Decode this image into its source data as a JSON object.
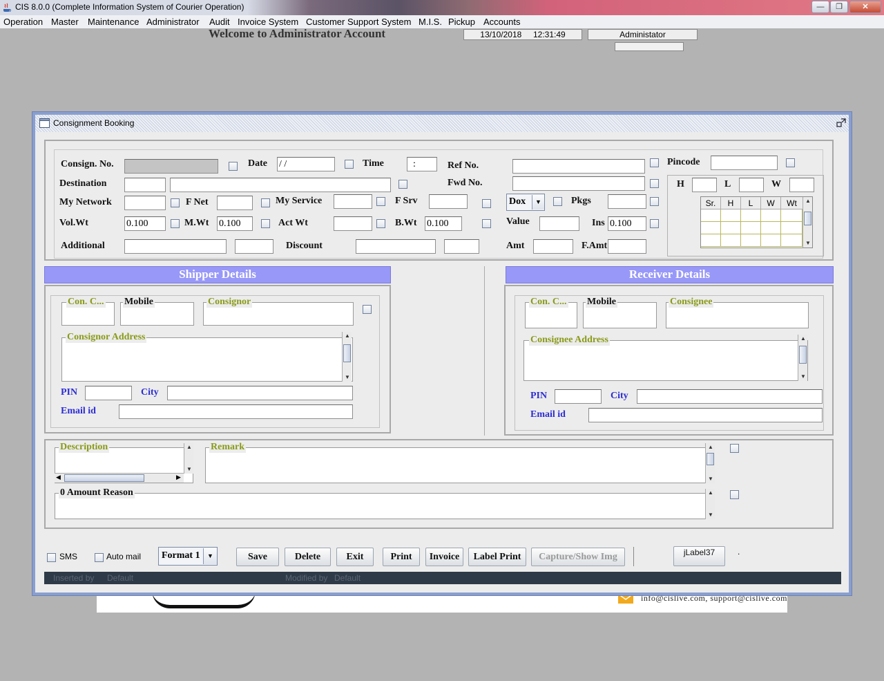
{
  "window": {
    "title": "CIS 8.0.0 (Complete Information System of Courier Operation)",
    "minimize_glyph": "—",
    "maximize_glyph": "❐",
    "close_glyph": "✕"
  },
  "menu": [
    "Operation",
    "Master",
    "Maintenance",
    "Administrator",
    "Audit",
    "Invoice System",
    "Customer Support System",
    "M.I.S.",
    "Pickup",
    "Accounts"
  ],
  "header": {
    "welcome": "Welcome to Administrator Account",
    "date": "13/10/2018",
    "time": "12:31:49",
    "user": "Administator"
  },
  "background_footer": {
    "emails": "info@cislive.com, support@cislive.com"
  },
  "frame": {
    "title": "Consignment Booking"
  },
  "booking": {
    "consign_no_label": "Consign. No.",
    "date_label": "Date",
    "date_value": " /  /",
    "time_label": "Time",
    "time_value": ":",
    "ref_no_label": "Ref No.",
    "pincode_label": "Pincode",
    "destination_label": "Destination",
    "fwd_no_label": "Fwd No.",
    "my_network_label": "My Network",
    "f_net_label": "F Net",
    "my_service_label": "My Service",
    "f_srv_label": "F Srv",
    "dox_value": "Dox",
    "pkgs_label": "Pkgs",
    "vol_wt_label": "Vol.Wt",
    "vol_wt_value": "0.100",
    "m_wt_label": "M.Wt",
    "m_wt_value": "0.100",
    "act_wt_label": "Act Wt",
    "b_wt_label": "B.Wt",
    "b_wt_value": "0.100",
    "value_label": "Value",
    "ins_label": "Ins",
    "ins_value": "0.100",
    "additional_label": "Additional",
    "discount_label": "Discount",
    "amt_label": "Amt",
    "f_amt_label": "F.Amt"
  },
  "dimensions": {
    "h_label": "H",
    "l_label": "L",
    "w_label": "W",
    "columns": [
      "Sr.",
      "H",
      "L",
      "W",
      "Wt"
    ]
  },
  "shipper": {
    "header": "Shipper Details",
    "con_code_label": "Con. C...",
    "mobile_label": "Mobile",
    "name_label": "Consignor",
    "address_label": "Consignor Address",
    "pin_label": "PIN",
    "city_label": "City",
    "email_label": "Email id"
  },
  "receiver": {
    "header": "Receiver Details",
    "con_code_label": "Con. C...",
    "mobile_label": "Mobile",
    "name_label": "Consignee",
    "address_label": "Consignee Address",
    "pin_label": "PIN",
    "city_label": "City",
    "email_label": "Email id"
  },
  "notes": {
    "description_label": "Description",
    "remark_label": "Remark",
    "zero_amount_label": "0 Amount Reason"
  },
  "actions": {
    "sms_label": "SMS",
    "auto_mail_label": "Auto mail",
    "format_value": "Format 1",
    "save": "Save",
    "delete": "Delete",
    "exit": "Exit",
    "print": "Print",
    "invoice": "Invoice",
    "label_print": "Label Print",
    "capture": "Capture/Show Img",
    "jlabel": "jLabel37",
    "dot": "."
  },
  "status": {
    "inserted_by": "Inserted by",
    "inserted_value": "Default",
    "modified_by": "Modified by",
    "modified_value": "Default"
  },
  "colors": {
    "section_header": "#9898f8",
    "label_blue": "#2c2cd4",
    "label_green": "#8a9a18",
    "status_bar": "#2f3a48"
  }
}
